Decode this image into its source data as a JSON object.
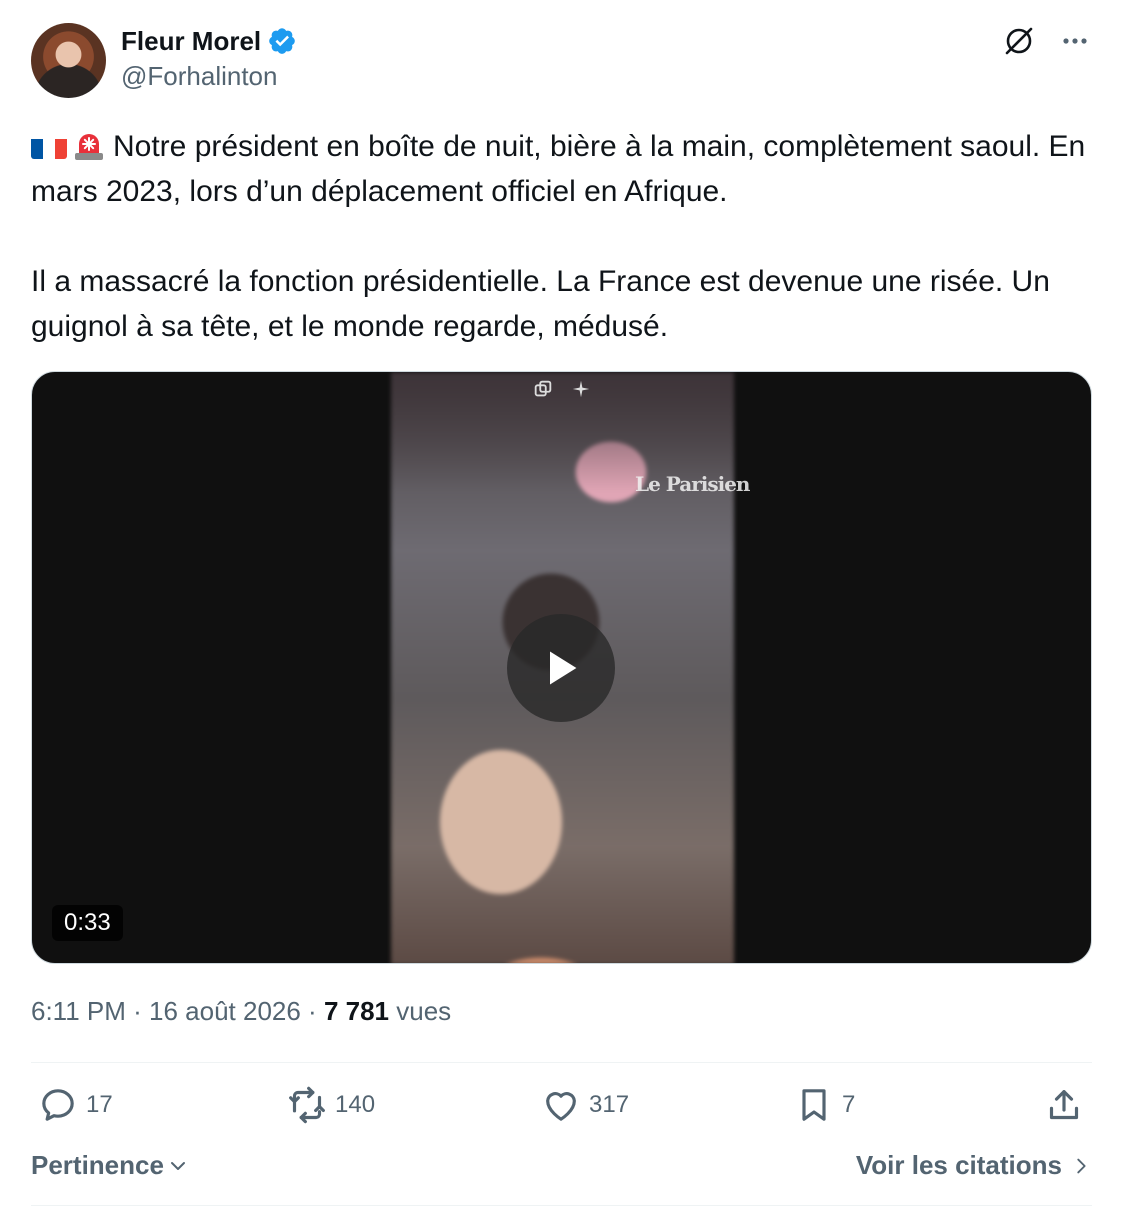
{
  "author": {
    "display_name": "Fleur Morel",
    "handle": "@Forhalinton"
  },
  "tweet": {
    "line1": "Notre président en boîte de nuit, bière à la main, complètement saoul. En mars 2023, lors d’un déplacement officiel en Afrique.",
    "line2": "Il a massacré la fonction présidentielle. La France est devenue une risée. Un guignol à sa tête, et le monde regarde, médusé."
  },
  "media": {
    "watermark": "Le Parisien",
    "duration": "0:33"
  },
  "meta": {
    "time": "6:11 PM",
    "separator": " · ",
    "date": "16 août 2026",
    "views_count": "7 781",
    "views_label": "vues"
  },
  "actions": {
    "replies": "17",
    "reposts": "140",
    "likes": "317",
    "bookmarks": "7"
  },
  "footer": {
    "sort_label": "Pertinence",
    "quotes_label": "Voir les citations"
  },
  "colors": {
    "text": "#0f1419",
    "secondary": "#536471",
    "verified": "#1d9bf0"
  }
}
